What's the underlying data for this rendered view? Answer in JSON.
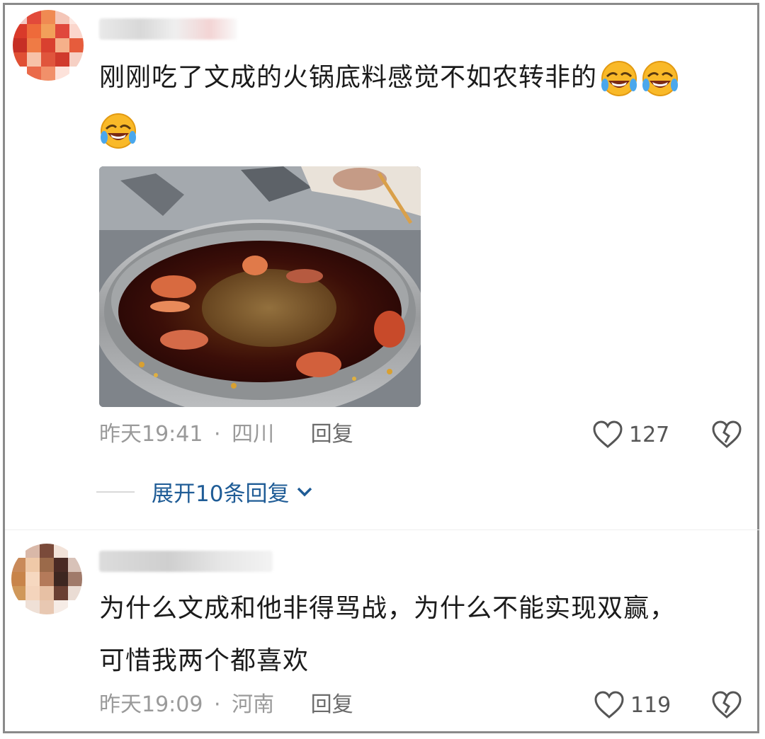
{
  "comments": [
    {
      "text_line1": "刚刚吃了文成的火锅底料感觉不如农转非的",
      "emojis": [
        "laugh-cry-emoji",
        "laugh-cry-emoji",
        "laugh-cry-emoji"
      ],
      "time": "昨天19:41",
      "separator": "·",
      "location": "四川",
      "reply_label": "回复",
      "likes": "127",
      "expand_replies": "展开10条回复"
    },
    {
      "text_line1": "为什么文成和他非得骂战，为什么不能实现双赢，",
      "text_line2": "可惜我两个都喜欢",
      "time": "昨天19:09",
      "separator": "·",
      "location": "河南",
      "reply_label": "回复",
      "likes": "119"
    }
  ],
  "colors": {
    "link_blue": "#1f5c96",
    "meta_gray": "#9a9a9a",
    "text": "#1b1b1b"
  },
  "icons": [
    "heart-outline-icon",
    "broken-heart-icon",
    "chevron-down-icon"
  ]
}
